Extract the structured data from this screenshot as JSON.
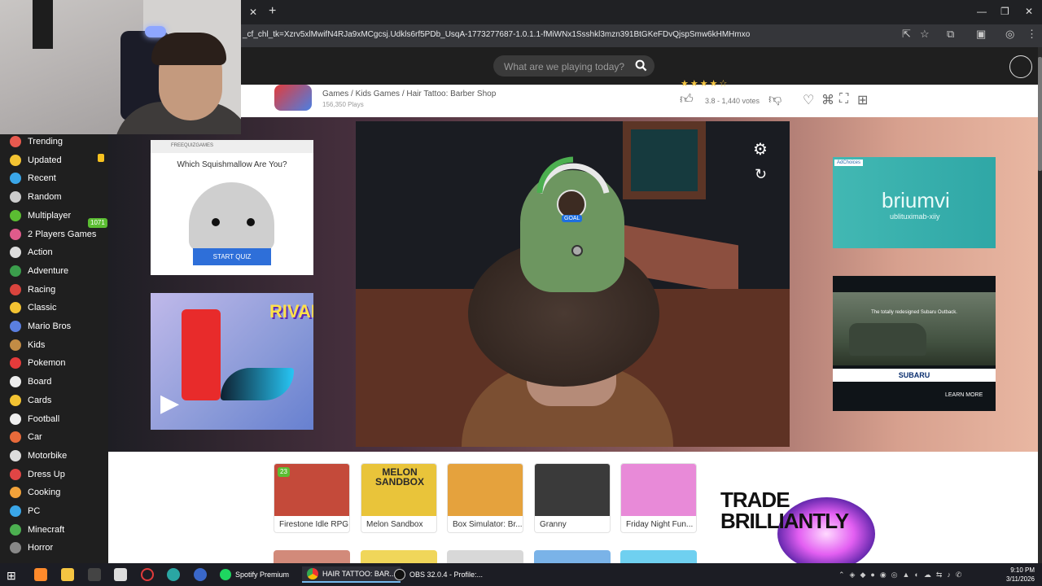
{
  "browser": {
    "url": "_cf_chl_tk=Xzrv5xlMwifN4RJa9xMCgcsj.Udkls6rf5PDb_UsqA-1773277687-1.0.1.1-fMiWNx1Ssshkl3mzn391BtGKeFDvQjspSmw6kHMHmxo"
  },
  "site": {
    "search_placeholder": "What are we playing today?"
  },
  "sidebar": {
    "items": [
      {
        "label": "Trending",
        "icon": "trending-icon",
        "color": "#e85a4f"
      },
      {
        "label": "Updated",
        "icon": "updated-icon",
        "color": "#f3c332"
      },
      {
        "label": "Recent",
        "icon": "recent-icon",
        "color": "#3aa6e8"
      },
      {
        "label": "Random",
        "icon": "shuffle-icon",
        "color": "#cccccc"
      },
      {
        "label": "Multiplayer",
        "icon": "multiplayer-icon",
        "color": "#5bbd32"
      },
      {
        "label": "2 Players Games",
        "icon": "two-players-icon",
        "color": "#e05b8b"
      },
      {
        "label": "Action",
        "icon": "action-icon",
        "color": "#dddddd"
      },
      {
        "label": "Adventure",
        "icon": "adventure-icon",
        "color": "#3b9e4c"
      },
      {
        "label": "Racing",
        "icon": "racing-icon",
        "color": "#d9443d"
      },
      {
        "label": "Classic",
        "icon": "classic-icon",
        "color": "#f3c332"
      },
      {
        "label": "Mario Bros",
        "icon": "mario-icon",
        "color": "#5a7fe0"
      },
      {
        "label": "Kids",
        "icon": "kids-icon",
        "color": "#c28c45"
      },
      {
        "label": "Pokemon",
        "icon": "pokeball-icon",
        "color": "#e53b3b"
      },
      {
        "label": "Board",
        "icon": "board-icon",
        "color": "#eeeeee"
      },
      {
        "label": "Cards",
        "icon": "cards-icon",
        "color": "#f3c332"
      },
      {
        "label": "Football",
        "icon": "football-icon",
        "color": "#eeeeee"
      },
      {
        "label": "Car",
        "icon": "car-icon",
        "color": "#e86a3a"
      },
      {
        "label": "Motorbike",
        "icon": "motorbike-icon",
        "color": "#dddddd"
      },
      {
        "label": "Dress Up",
        "icon": "dress-icon",
        "color": "#e04545"
      },
      {
        "label": "Cooking",
        "icon": "cooking-icon",
        "color": "#f2a23a"
      },
      {
        "label": "PC",
        "icon": "pc-icon",
        "color": "#3aa6e8"
      },
      {
        "label": "Minecraft",
        "icon": "minecraft-icon",
        "color": "#4caf50"
      },
      {
        "label": "Horror",
        "icon": "horror-icon",
        "color": "#888888"
      }
    ],
    "multiplayer_badge": "1071"
  },
  "game": {
    "breadcrumb_games": "Games",
    "breadcrumb_kids": "Kids Games",
    "title": "Hair Tattoo: Barber Shop",
    "plays": "156,350 Plays",
    "rating": "3.8 - 1,440 votes",
    "goal_label": "GOAL"
  },
  "ads": {
    "quiz_brand": "FREEQUIZGAMES",
    "quiz_title": "Which Squishmallow Are You?",
    "quiz_cta": "START QUIZ",
    "rivals_logo": "RIVALS",
    "briumvi_choices": "AdChoices",
    "briumvi_brand": "briumvi",
    "briumvi_sub": "ublituximab-xiiy",
    "subaru_tagline": "The totally redesigned Subaru Outback.",
    "subaru_brand": "SUBARU",
    "subaru_cta": "LEARN MORE",
    "trade_text": "TRADE BRILLIANTLY"
  },
  "recommended": [
    {
      "title": "Firestone Idle RPG",
      "count": "23",
      "color": "#c44a3a"
    },
    {
      "title": "Melon Sandbox",
      "logo": "MELON SANDBOX",
      "color": "#e9c43a"
    },
    {
      "title": "Box Simulator: Br...",
      "color": "#e5a23d"
    },
    {
      "title": "Granny",
      "color": "#3a3a3a"
    },
    {
      "title": "Friday Night Fun...",
      "color": "#e88ad8"
    }
  ],
  "taskbar": {
    "spotify": "Spotify Premium",
    "chrome": "HAIR TATTOO: BAR...",
    "obs": "OBS 32.0.4 - Profile:...",
    "time": "9:10 PM",
    "date": "3/11/2026"
  }
}
